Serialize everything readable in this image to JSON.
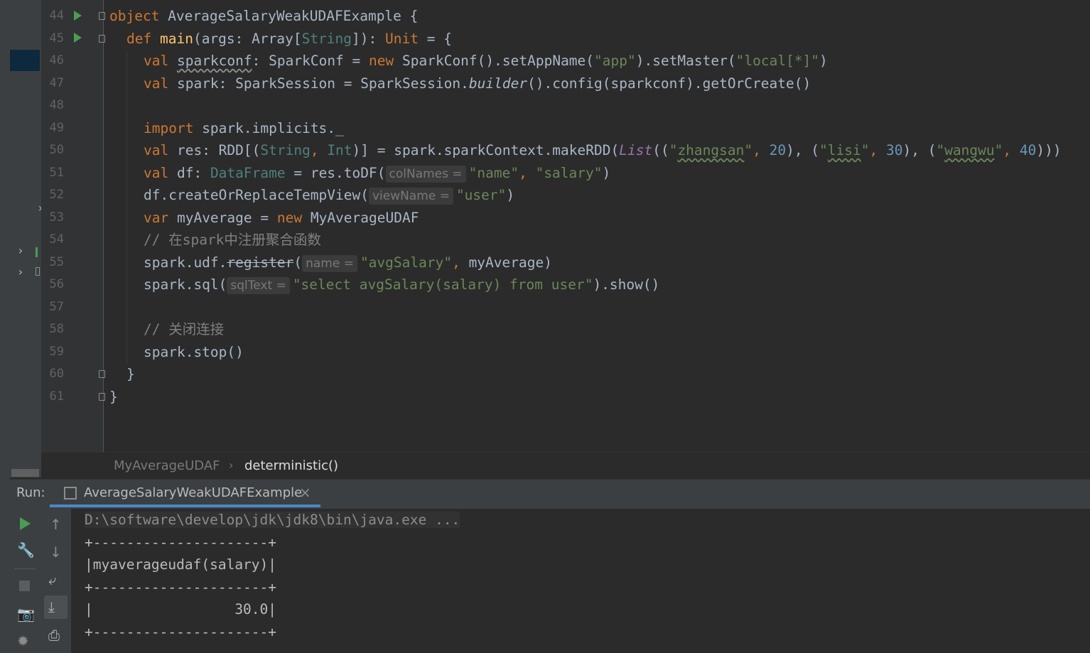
{
  "editor": {
    "line_numbers": [
      "44",
      "45",
      "46",
      "47",
      "48",
      "49",
      "50",
      "51",
      "52",
      "53",
      "54",
      "55",
      "56",
      "57",
      "58",
      "59",
      "60",
      "61"
    ],
    "l44": {
      "kw": "object",
      "name": " AverageSalaryWeakUDAFExample {"
    },
    "l45": {
      "kw": "def",
      "fn": "main",
      "p1": "(args: Array[",
      "tp": "String",
      "p2": "]): ",
      "kw2": "Unit",
      "p3": " = {"
    },
    "l46": {
      "kw": "val",
      "var": "sparkconf",
      "p1": ": SparkConf = ",
      "kw2": "new",
      "p2": " SparkConf().setAppName(",
      "s1": "\"app\"",
      "p3": ").setMaster(",
      "s2": "\"local[*]\"",
      "p4": ")"
    },
    "l47": {
      "kw": "val",
      "p1": " spark: SparkSession = SparkSession.",
      "it": "builder",
      "p2": "().config(sparkconf).getOrCreate()"
    },
    "l49": {
      "kw": "import",
      "p1": " spark.implicits._"
    },
    "l50": {
      "kw": "val",
      "p1": " res: RDD[(",
      "tp1": "String",
      "c1": ", ",
      "tp2": "Int",
      "p2": ")] = spark.sparkContext.makeRDD(",
      "lst": "List",
      "p3": "((",
      "s1q": "\"",
      "s1": "zhangsan",
      "s1e": "\"",
      "c2": ", ",
      "n1": "20",
      "p4": "), (",
      "s2q": "\"",
      "s2": "lisi",
      "s2e": "\"",
      "c3": ", ",
      "n2": "30",
      "p5": "), (",
      "s3q": "\"",
      "s3": "wangwu",
      "s3e": "\"",
      "c4": ", ",
      "n3": "40",
      "p6": ")))"
    },
    "l51": {
      "kw": "val",
      "p1": " df: ",
      "tp": "DataFrame",
      "p2": " = res.toDF(",
      "hint": "colNames =",
      "s1": "\"name\"",
      "c1": ", ",
      "s2": "\"salary\"",
      "p3": ")"
    },
    "l52": {
      "p1": "df.createOrReplaceTempView(",
      "hint": "viewName =",
      "s1": "\"user\"",
      "p2": ")"
    },
    "l53": {
      "kw": "var",
      "p1": " myAverage = ",
      "kw2": "new",
      "p2": " MyAverageUDAF"
    },
    "l54": {
      "cm": "// 在spark中注册聚合函数"
    },
    "l55": {
      "p1": "spark.udf.",
      "strike": "register",
      "p2": "(",
      "hint": "name =",
      "s1": "\"avgSalary\"",
      "c1": ", ",
      "p3": "myAverage)"
    },
    "l56": {
      "p1": "spark.sql(",
      "hint": "sqlText =",
      "s1": "\"select avgSalary(salary) from user\"",
      "p2": ").show()"
    },
    "l58": {
      "cm": "// 关闭连接"
    },
    "l59": {
      "p1": "spark.stop()"
    },
    "l60": {
      "p1": "}"
    },
    "l61": {
      "p1": "}"
    }
  },
  "breadcrumb": {
    "class_name": "MyAverageUDAF",
    "separator": "›",
    "method": "deterministic()"
  },
  "run_panel": {
    "label": "Run:",
    "tab_title": "AverageSalaryWeakUDAFExample",
    "tab_close": "×",
    "output": [
      "D:\\software\\develop\\jdk\\jdk8\\bin\\java.exe ...",
      "+---------------------+",
      "|myaverageudaf(salary)|",
      "+---------------------+",
      "|                 30.0|",
      "+---------------------+"
    ]
  },
  "icons": [
    "run-icon",
    "wrench-icon",
    "stop-icon",
    "camera-icon",
    "bug-icon",
    "arrow-up-icon",
    "arrow-down-icon",
    "soft-wrap-icon",
    "scroll-to-end-icon",
    "print-icon"
  ],
  "colors": {
    "background": "#2b2b2b",
    "keyword": "#cc7832",
    "string": "#6a8759",
    "number": "#6897bb",
    "function": "#ffc66d",
    "run_green": "#499c54",
    "tab_accent": "#4a88c7"
  }
}
